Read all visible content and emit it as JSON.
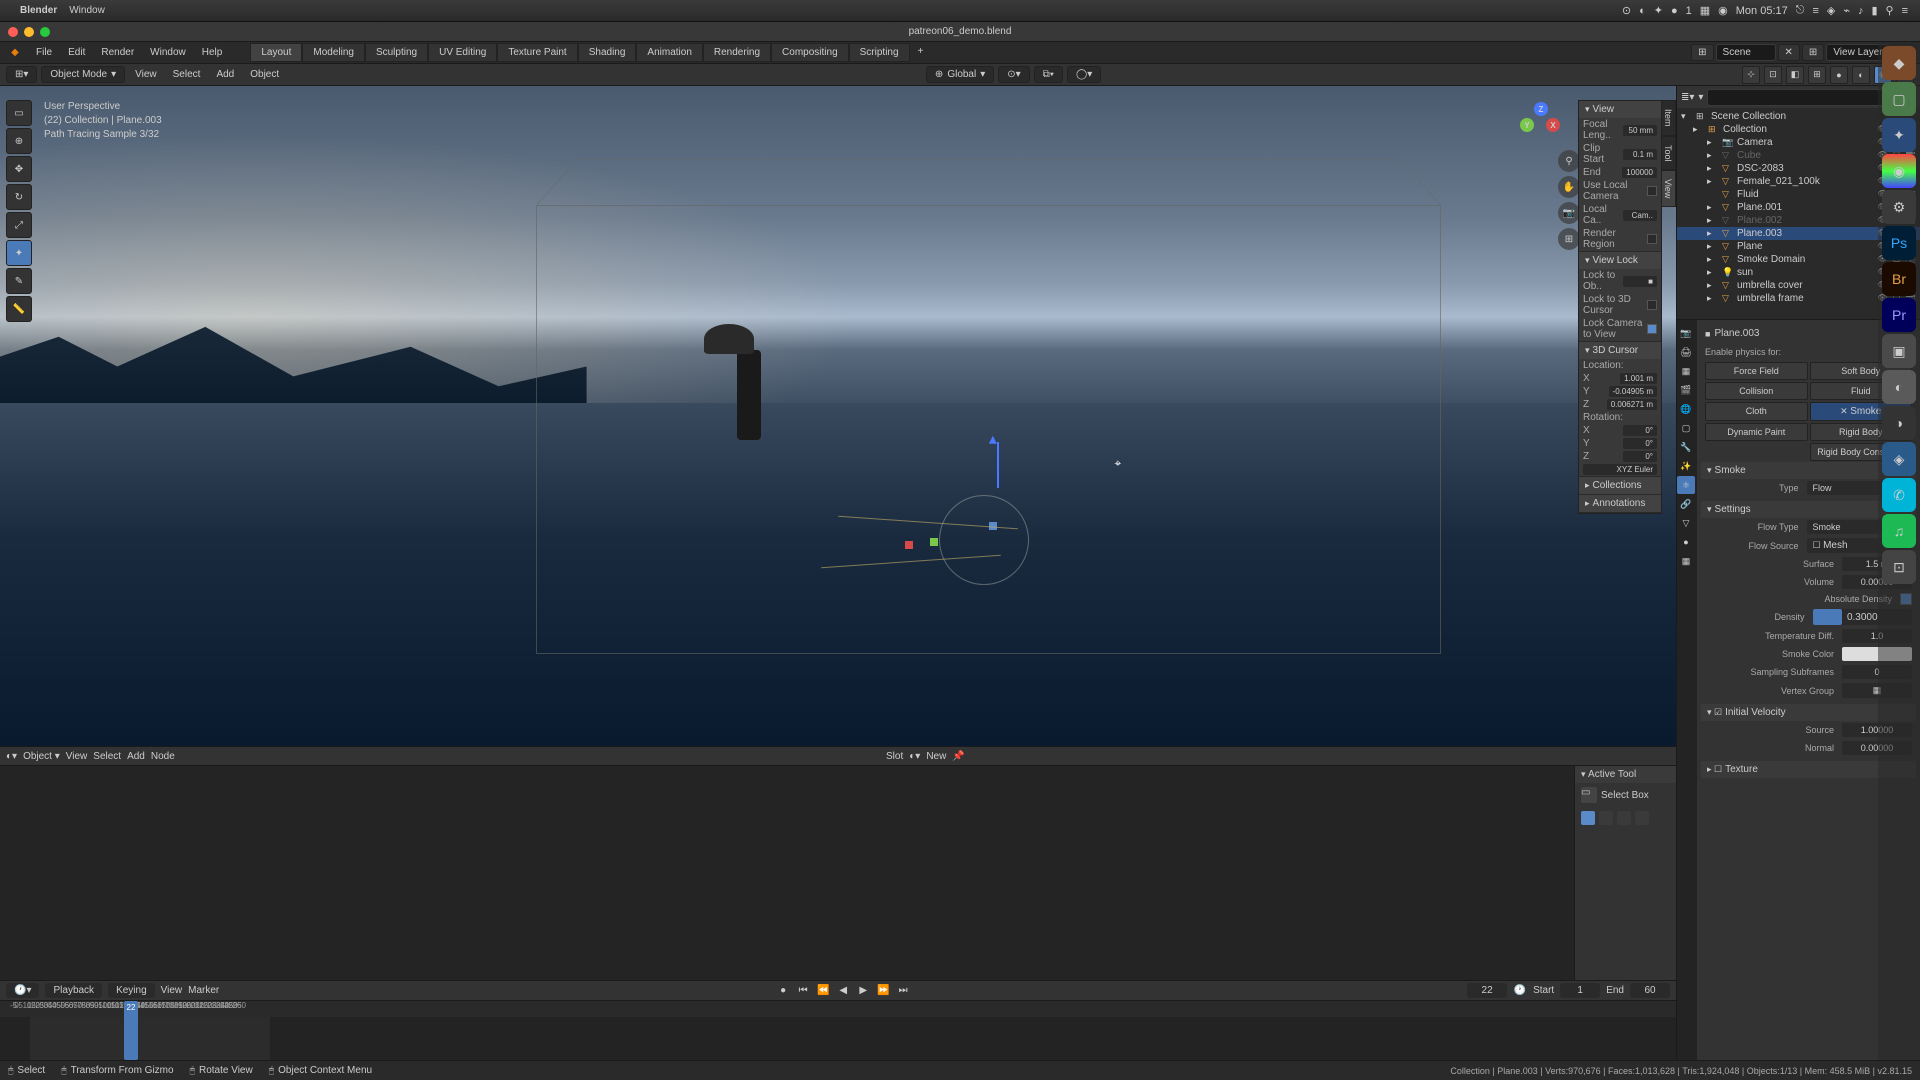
{
  "macos": {
    "app": "Blender",
    "menu": [
      "Window"
    ],
    "clock": "Mon 05:17"
  },
  "titlebar": {
    "filename": "patreon06_demo.blend"
  },
  "topmenu": {
    "items": [
      "File",
      "Edit",
      "Render",
      "Window",
      "Help"
    ],
    "workspaces": [
      "Layout",
      "Modeling",
      "Sculpting",
      "UV Editing",
      "Texture Paint",
      "Shading",
      "Animation",
      "Rendering",
      "Compositing",
      "Scripting"
    ],
    "scene_label": "Scene",
    "viewlayer_label": "View Layer"
  },
  "header3d": {
    "mode": "Object Mode",
    "menus": [
      "View",
      "Select",
      "Add",
      "Object"
    ],
    "orient_label": "Global"
  },
  "viewport": {
    "perspective": "User Perspective",
    "object": "(22) Collection | Plane.003",
    "sample": "Path Tracing Sample 3/32"
  },
  "npanel": {
    "view": "View",
    "focal_label": "Focal Leng..",
    "focal_val": "50 mm",
    "clipstart_label": "Clip Start",
    "clipstart_val": "0.1 m",
    "clipend_label": "End",
    "clipend_val": "100000",
    "localcam_label": "Use Local Camera",
    "localcam_field": "Local Ca..",
    "cam_opt": "Cam..",
    "renderregion_label": "Render Region",
    "viewlock": "View Lock",
    "lockobj_label": "Lock to Ob..",
    "lock3dcursor_label": "Lock to 3D Cursor",
    "lockcamview_label": "Lock Camera to View",
    "cursor3d": "3D Cursor",
    "location": "Location:",
    "x": "X",
    "y": "Y",
    "z": "Z",
    "loc_x": "1.001 m",
    "loc_y": "-0.04905 m",
    "loc_z": "0.006271 m",
    "rotation": "Rotation:",
    "rot_x": "0°",
    "rot_y": "0°",
    "rot_z": "0°",
    "xyz_euler": "XYZ Euler",
    "collections": "Collections",
    "annotations": "Annotations"
  },
  "shader": {
    "menus": [
      "Object",
      "View",
      "Select",
      "Add",
      "Node"
    ],
    "slot": "Slot",
    "new": "New"
  },
  "toolpanel": {
    "header": "Active Tool",
    "tool": "Select Box"
  },
  "timeline": {
    "menus": [
      "Playback",
      "Keying",
      "View",
      "Marker"
    ],
    "current": "22",
    "start_label": "Start",
    "start": "1",
    "end_label": "End",
    "end": "60",
    "ticks": [
      -5,
      0,
      5,
      10,
      15,
      20,
      25,
      30,
      35,
      40,
      45,
      50,
      55,
      60,
      65,
      70,
      75,
      80,
      85,
      90,
      95,
      100,
      105,
      110,
      115,
      120,
      125,
      130,
      135,
      140,
      145,
      150,
      155,
      160,
      165,
      170,
      175,
      180,
      185,
      190,
      195,
      200,
      205,
      210,
      215,
      220,
      225,
      230,
      235,
      240,
      245,
      250,
      255,
      260
    ]
  },
  "outliner": {
    "scene": "Scene Collection",
    "items": [
      {
        "name": "Collection",
        "indent": 1,
        "icon": "▸",
        "type": "col"
      },
      {
        "name": "Camera",
        "indent": 2,
        "icon": "▸",
        "type": "cam"
      },
      {
        "name": "Cube",
        "indent": 2,
        "icon": "▸",
        "type": "mesh",
        "dim": true
      },
      {
        "name": "DSC-2083",
        "indent": 2,
        "icon": "▸",
        "type": "mesh"
      },
      {
        "name": "Female_021_100k",
        "indent": 2,
        "icon": "▸",
        "type": "mesh"
      },
      {
        "name": "Fluid",
        "indent": 2,
        "icon": "",
        "type": "mesh"
      },
      {
        "name": "Plane.001",
        "indent": 2,
        "icon": "▸",
        "type": "mesh"
      },
      {
        "name": "Plane.002",
        "indent": 2,
        "icon": "▸",
        "type": "mesh",
        "dim": true
      },
      {
        "name": "Plane.003",
        "indent": 2,
        "icon": "▸",
        "type": "mesh",
        "sel": true
      },
      {
        "name": "Plane",
        "indent": 2,
        "icon": "▸",
        "type": "mesh"
      },
      {
        "name": "Smoke Domain",
        "indent": 2,
        "icon": "▸",
        "type": "mesh"
      },
      {
        "name": "sun",
        "indent": 2,
        "icon": "▸",
        "type": "light"
      },
      {
        "name": "umbrella cover",
        "indent": 2,
        "icon": "▸",
        "type": "mesh"
      },
      {
        "name": "umbrella frame",
        "indent": 2,
        "icon": "▸",
        "type": "mesh"
      }
    ]
  },
  "props": {
    "breadcrumb": "Plane.003",
    "enable_label": "Enable physics for:",
    "buttons": [
      "Force Field",
      "Soft Body",
      "Collision",
      "Fluid",
      "Cloth",
      "Smoke",
      "Dynamic Paint",
      "Rigid Body",
      "",
      "Rigid Body Constraint"
    ],
    "smoke_hdr": "Smoke",
    "type_label": "Type",
    "type_val": "Flow",
    "settings_hdr": "Settings",
    "flowtype_label": "Flow Type",
    "flowtype_val": "Smoke",
    "flowsource_label": "Flow Source",
    "flowsource_val": "Mesh",
    "surface_label": "Surface",
    "surface_val": "1.5 m",
    "volume_label": "Volume",
    "volume_val": "0.00000",
    "absdens_label": "Absolute Density",
    "density_label": "Density",
    "density_val": "0.3000",
    "tempdiff_label": "Temperature Diff.",
    "tempdiff_val": "1.0",
    "smokecolor_label": "Smoke Color",
    "subframes_label": "Sampling Subframes",
    "subframes_val": "0",
    "vgroup_label": "Vertex Group",
    "initvel_hdr": "Initial Velocity",
    "source_label": "Source",
    "source_val": "1.00000",
    "normal_label": "Normal",
    "normal_val": "0.00000",
    "texture_hdr": "Texture"
  },
  "statusbar": {
    "select": "Select",
    "transform": "Transform From Gizmo",
    "rotate": "Rotate View",
    "context": "Object Context Menu",
    "info": "Collection | Plane.003 | Verts:970,676 | Faces:1,013,628 | Tris:1,924,048 | Objects:1/13 | Mem: 458.5 MiB | v2.81.15"
  }
}
